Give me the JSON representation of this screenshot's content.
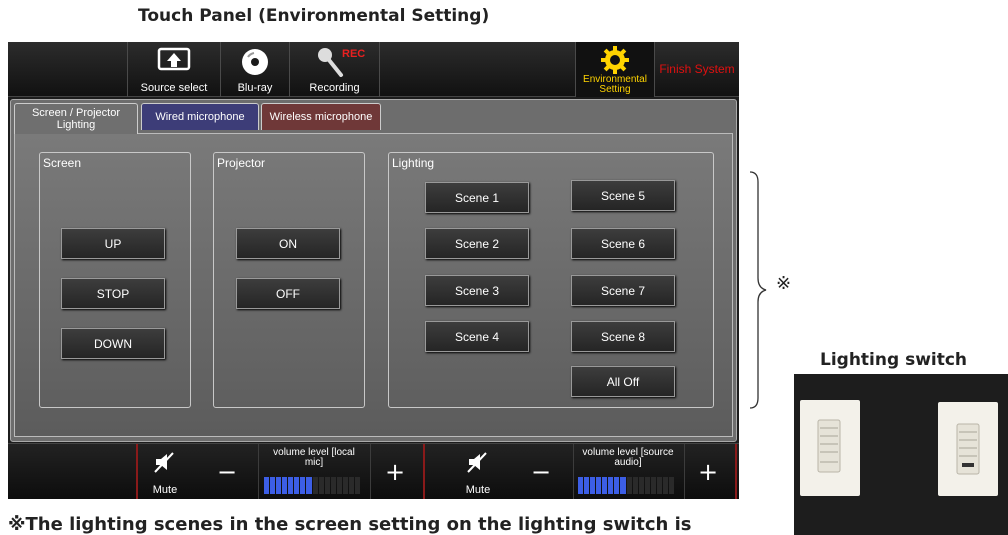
{
  "headings": {
    "panel": "Touch Panel (Environmental Setting)",
    "switch": "Lighting switch",
    "footnote": "※The lighting scenes in the screen setting on the lighting switch is",
    "note_mark": "※"
  },
  "topbar": {
    "source_select": "Source select",
    "bluray": "Blu-ray",
    "recording": "Recording",
    "rec_badge": "REC",
    "environmental_setting": "Environmental Setting",
    "finish_system": "Finish System"
  },
  "tabs": {
    "screen_projector_lighting": "Screen / Projector Lighting",
    "wired_microphone": "Wired microphone",
    "wireless_microphone": "Wireless microphone"
  },
  "screen": {
    "title": "Screen",
    "up": "UP",
    "stop": "STOP",
    "down": "DOWN"
  },
  "projector": {
    "title": "Projector",
    "on": "ON",
    "off": "OFF"
  },
  "lighting": {
    "title": "Lighting",
    "scene1": "Scene 1",
    "scene2": "Scene 2",
    "scene3": "Scene 3",
    "scene4": "Scene 4",
    "scene5": "Scene 5",
    "scene6": "Scene 6",
    "scene7": "Scene 7",
    "scene8": "Scene 8",
    "all_off": "All Off"
  },
  "bottombar": {
    "mute_label": "Mute",
    "minus": "−",
    "plus": "+",
    "local_mic_label": "volume level [local mic]",
    "source_audio_label": "volume level [source audio]",
    "local_mic_level": 0.5,
    "source_audio_level": 0.5
  },
  "colors": {
    "accent_yellow": "#ffd400",
    "finish_red": "#e01010",
    "meter_blue": "#3c5ee6"
  }
}
